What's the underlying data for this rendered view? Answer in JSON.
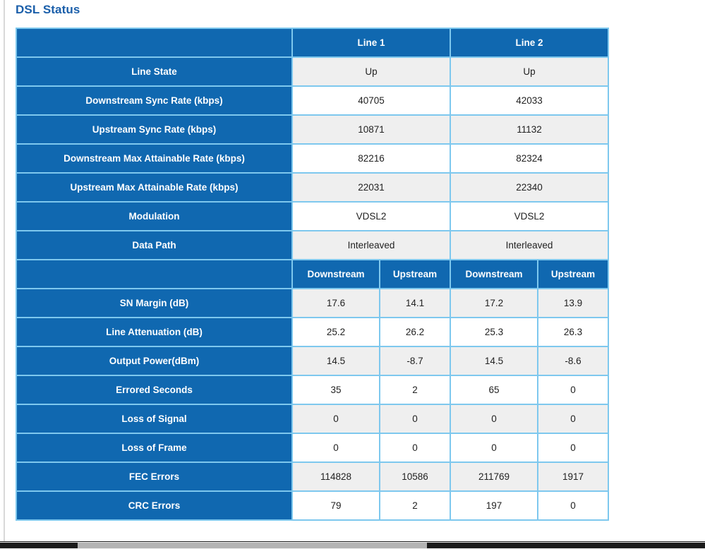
{
  "page": {
    "title": "DSL Status",
    "title_color": "#1b5faa",
    "header_bg": "#1068b0",
    "grid_color": "#7ec8ee",
    "shade_row_bg": "#efefef",
    "plain_row_bg": "#ffffff"
  },
  "table": {
    "line_headers": [
      "Line 1",
      "Line 2"
    ],
    "direction_headers": [
      "Downstream",
      "Upstream",
      "Downstream",
      "Upstream"
    ],
    "summary_rows": [
      {
        "label": "Line State",
        "line1": "Up",
        "line2": "Up"
      },
      {
        "label": "Downstream Sync Rate (kbps)",
        "line1": "40705",
        "line2": "42033"
      },
      {
        "label": "Upstream Sync Rate (kbps)",
        "line1": "10871",
        "line2": "11132"
      },
      {
        "label": "Downstream Max Attainable Rate (kbps)",
        "line1": "82216",
        "line2": "82324"
      },
      {
        "label": "Upstream Max Attainable Rate (kbps)",
        "line1": "22031",
        "line2": "22340"
      },
      {
        "label": "Modulation",
        "line1": "VDSL2",
        "line2": "VDSL2"
      },
      {
        "label": "Data Path",
        "line1": "Interleaved",
        "line2": "Interleaved"
      }
    ],
    "detail_rows": [
      {
        "label": "SN Margin (dB)",
        "values": [
          "17.6",
          "14.1",
          "17.2",
          "13.9"
        ]
      },
      {
        "label": "Line Attenuation (dB)",
        "values": [
          "25.2",
          "26.2",
          "25.3",
          "26.3"
        ]
      },
      {
        "label": "Output Power(dBm)",
        "values": [
          "14.5",
          "-8.7",
          "14.5",
          "-8.6"
        ]
      },
      {
        "label": "Errored Seconds",
        "values": [
          "35",
          "2",
          "65",
          "0"
        ]
      },
      {
        "label": "Loss of Signal",
        "values": [
          "0",
          "0",
          "0",
          "0"
        ]
      },
      {
        "label": "Loss of Frame",
        "values": [
          "0",
          "0",
          "0",
          "0"
        ]
      },
      {
        "label": "FEC Errors",
        "values": [
          "114828",
          "10586",
          "211769",
          "1917"
        ]
      },
      {
        "label": "CRC Errors",
        "values": [
          "79",
          "2",
          "197",
          "0"
        ]
      }
    ]
  }
}
